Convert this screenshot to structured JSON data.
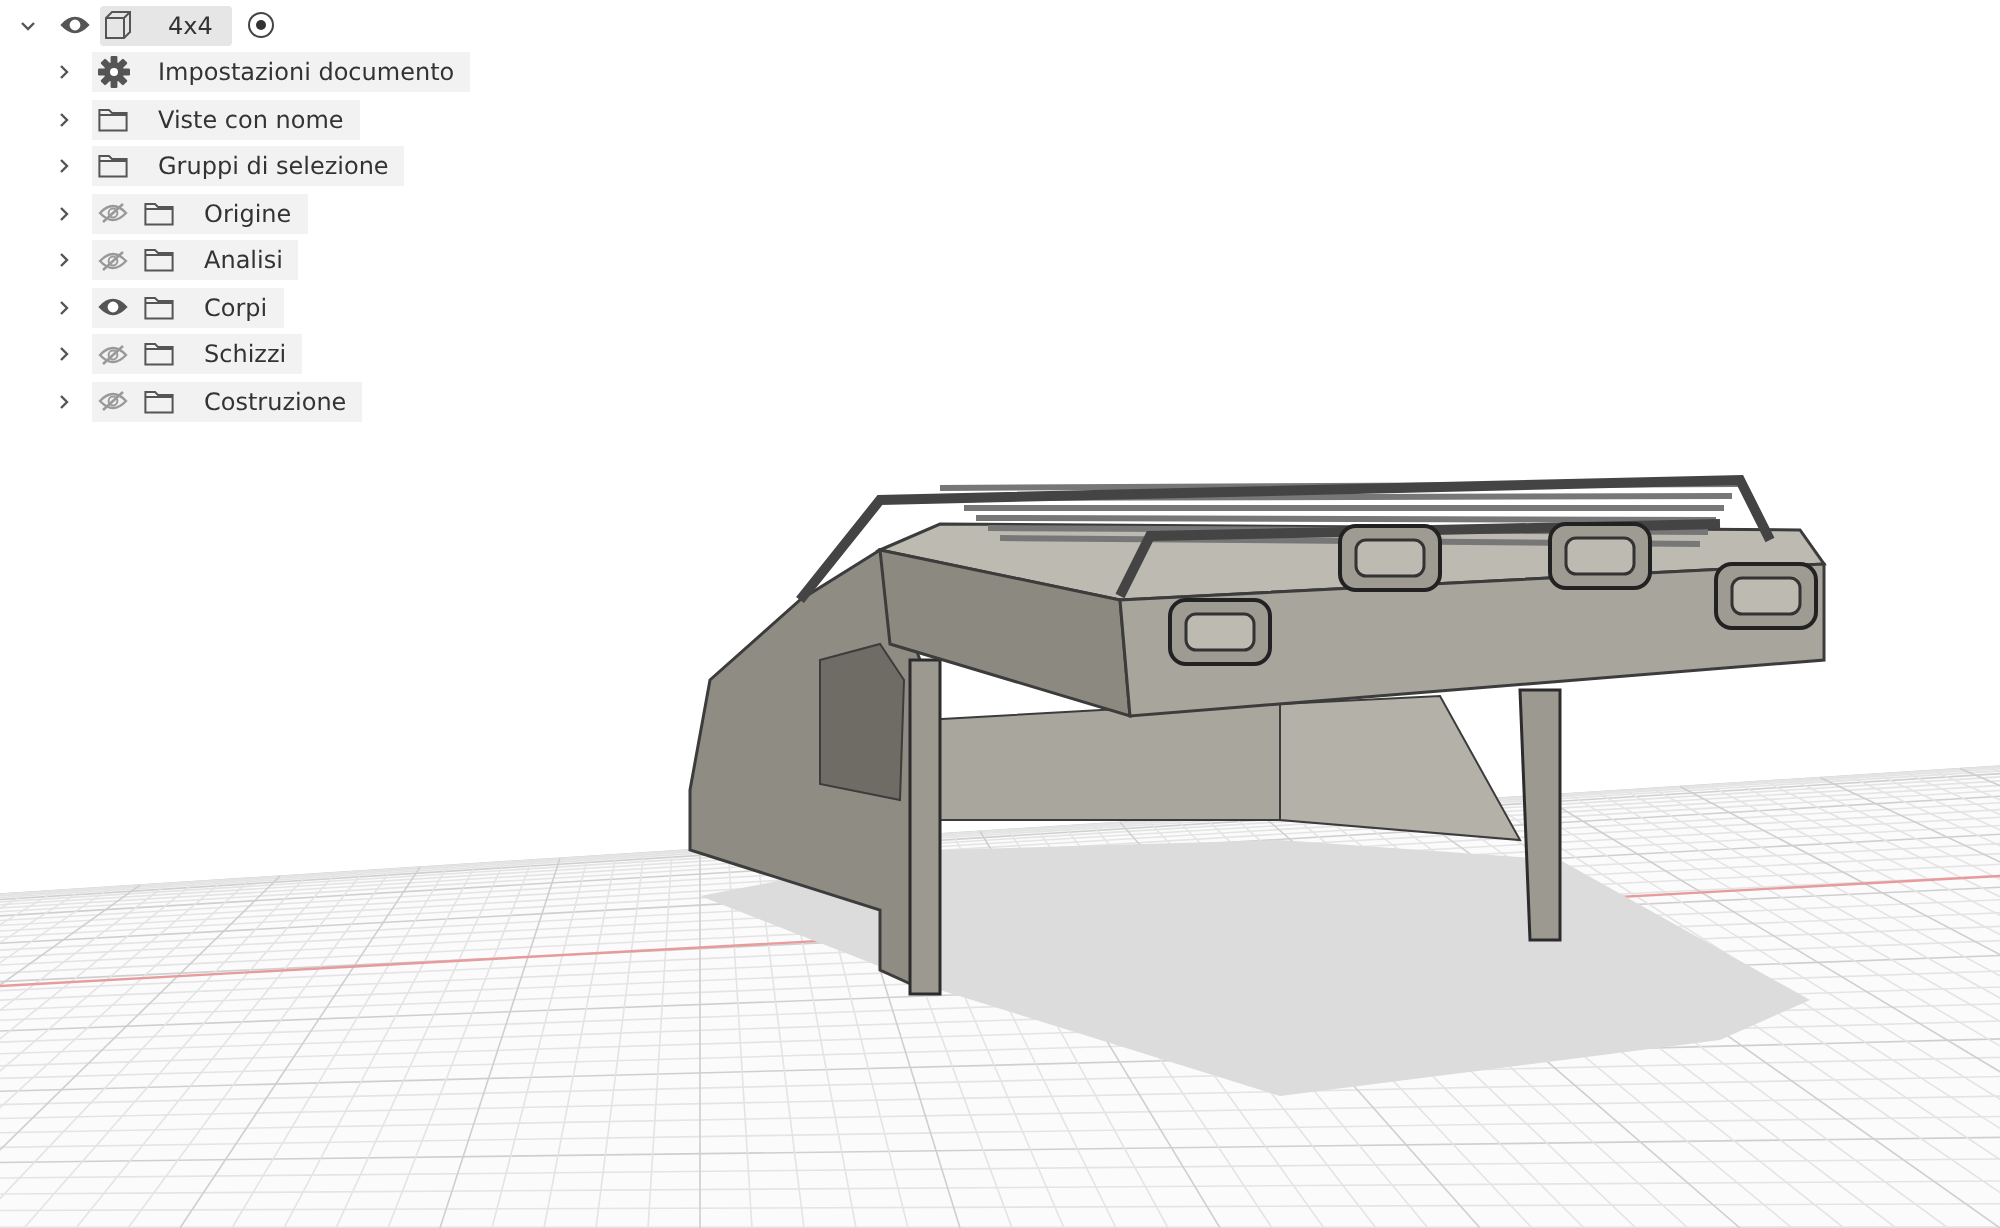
{
  "browser": {
    "root": {
      "label": "4x4",
      "visible": true,
      "expanded": true,
      "active": true,
      "children": [
        {
          "label": "Impostazioni documento",
          "kind": "settings",
          "expanded": false
        },
        {
          "label": "Viste con nome",
          "kind": "folder",
          "expanded": false
        },
        {
          "label": "Gruppi di selezione",
          "kind": "folder",
          "expanded": false
        },
        {
          "label": "Origine",
          "kind": "toggle-folder",
          "visible": false,
          "expanded": false
        },
        {
          "label": "Analisi",
          "kind": "toggle-folder",
          "visible": false,
          "expanded": false
        },
        {
          "label": "Corpi",
          "kind": "toggle-folder",
          "visible": true,
          "expanded": false
        },
        {
          "label": "Schizzi",
          "kind": "toggle-folder",
          "visible": false,
          "expanded": false
        },
        {
          "label": "Costruzione",
          "kind": "toggle-folder",
          "visible": false,
          "expanded": false
        }
      ]
    }
  }
}
